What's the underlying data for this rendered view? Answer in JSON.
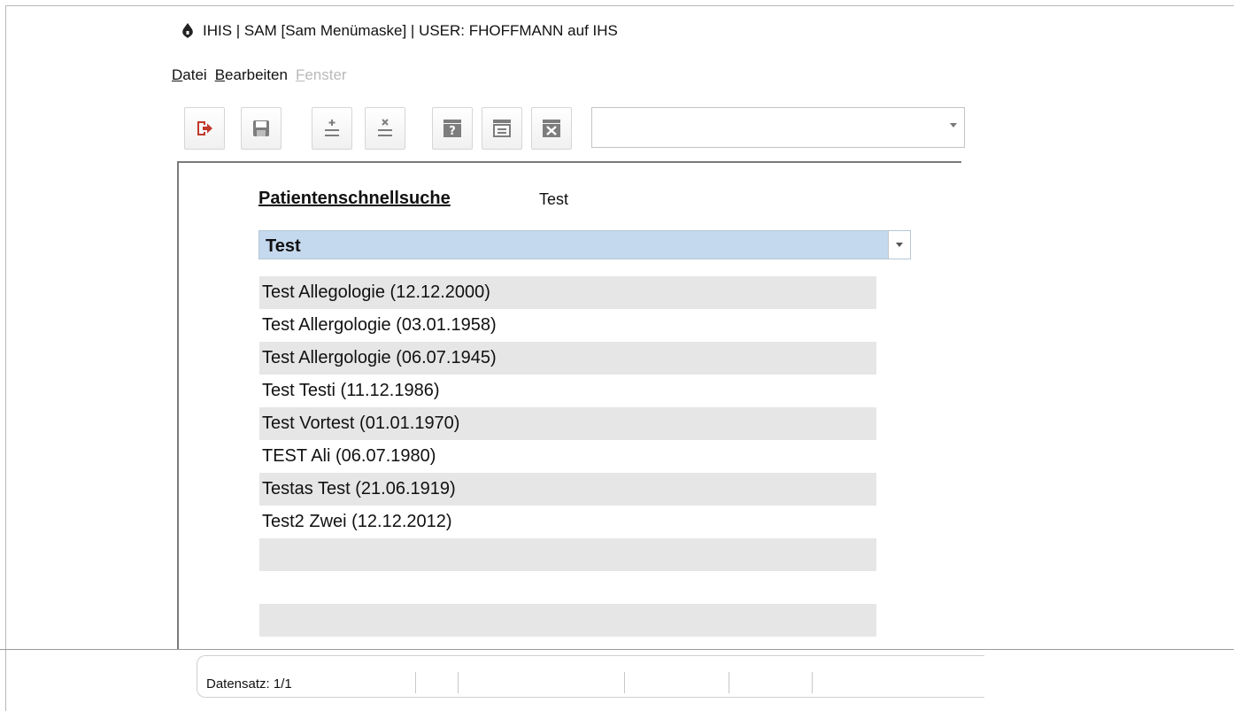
{
  "window": {
    "title": "IHIS | SAM [Sam Menümaske] | USER: FHOFFMANN auf IHS"
  },
  "menu": [
    {
      "label": "Datei",
      "mnemonic": "D",
      "rest": "atei",
      "enabled": true
    },
    {
      "label": "Bearbeiten",
      "mnemonic": "B",
      "rest": "earbeiten",
      "enabled": true
    },
    {
      "label": "Fenster",
      "mnemonic": "F",
      "rest": "enster",
      "enabled": false
    }
  ],
  "toolbar": {
    "icons": [
      "exit-icon",
      "save-icon",
      "add-record-icon",
      "delete-record-icon",
      "help-icon",
      "list-icon",
      "close-form-icon"
    ],
    "combo_value": ""
  },
  "search": {
    "title": "Patientenschnellsuche",
    "term": "Test",
    "selected": "Test"
  },
  "results": [
    "Test Allegologie (12.12.2000)",
    "Test Allergologie (03.01.1958)",
    "Test Allergologie (06.07.1945)",
    "Test Testi (11.12.1986)",
    "Test Vortest (01.01.1970)",
    "TEST Ali (06.07.1980)",
    "Testas Test (21.06.1919)",
    "Test2 Zwei (12.12.2012)",
    "",
    "",
    ""
  ],
  "status": {
    "record": "Datensatz: 1/1"
  },
  "colors": {
    "exit_red": "#c0392b",
    "selected_blue": "#c5d9ee",
    "row_alt": "#e6e6e6",
    "icon_gray": "#7d7d7d"
  }
}
